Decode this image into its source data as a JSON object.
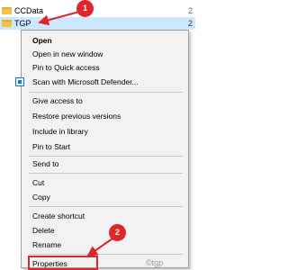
{
  "files": [
    {
      "name": "CCData",
      "date": "2"
    },
    {
      "name": "TGP",
      "date": "2"
    }
  ],
  "context_menu": {
    "items": [
      {
        "label": "Open",
        "bold": true
      },
      {
        "label": "Open in new window"
      },
      {
        "label": "Pin to Quick access"
      },
      {
        "label": "Scan with Microsoft Defender..."
      },
      {
        "label": "Give access to"
      },
      {
        "label": "Restore previous versions"
      },
      {
        "label": "Include in library"
      },
      {
        "label": "Pin to Start"
      },
      {
        "label": "Send to"
      },
      {
        "label": "Cut"
      },
      {
        "label": "Copy"
      },
      {
        "label": "Create shortcut"
      },
      {
        "label": "Delete"
      },
      {
        "label": "Rename"
      },
      {
        "label": "Properties"
      }
    ]
  },
  "annotations": {
    "step1": "1",
    "step2": "2",
    "color": "#e0262b"
  },
  "watermark": "©tgp"
}
